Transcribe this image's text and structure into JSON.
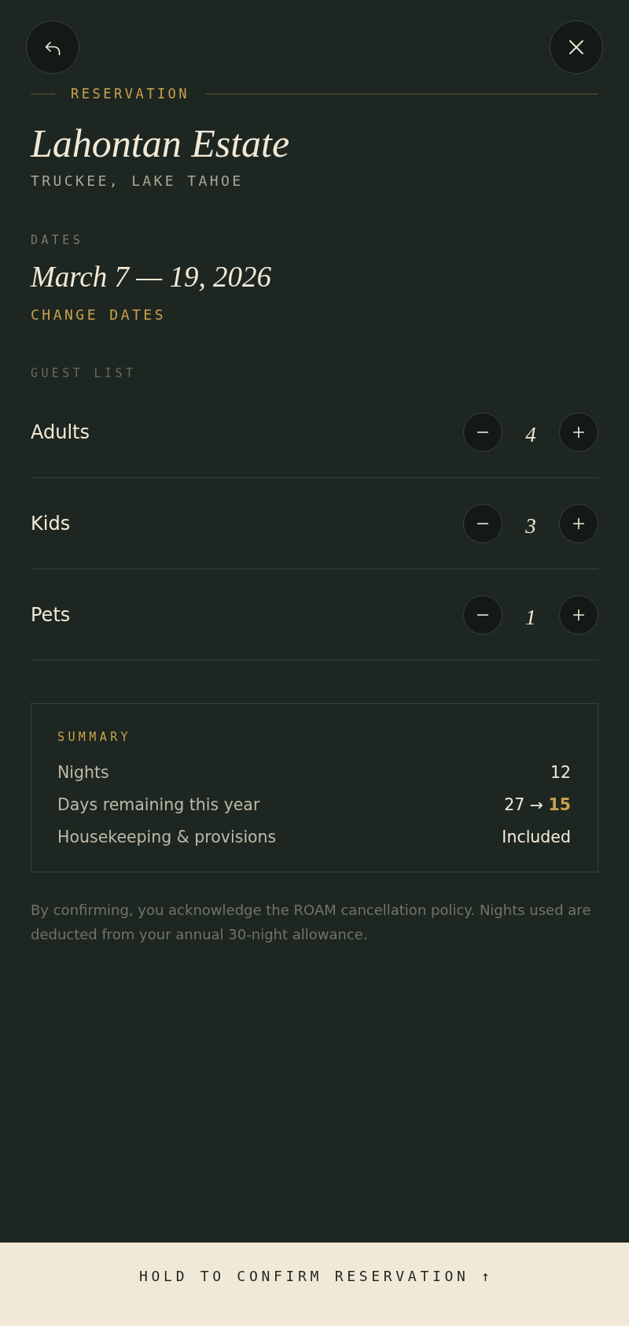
{
  "eyebrow": "RESERVATION",
  "property": {
    "name": "Lahontan Estate",
    "location": "TRUCKEE, LAKE TAHOE"
  },
  "dates": {
    "label": "DATES",
    "range": "March 7 — 19, 2026",
    "action": "CHANGE DATES"
  },
  "guests": {
    "label": "GUEST LIST",
    "rows": [
      {
        "label": "Adults",
        "count": "4"
      },
      {
        "label": "Kids",
        "count": "3"
      },
      {
        "label": "Pets",
        "count": "1"
      }
    ]
  },
  "summary": {
    "title": "SUMMARY",
    "rows": [
      {
        "label": "Nights",
        "value": "12"
      },
      {
        "label": "Days remaining this year",
        "value": "27 → **15**"
      },
      {
        "label": "Housekeeping & provisions",
        "value": "Included"
      }
    ]
  },
  "disclaimer": "By confirming, you acknowledge the ROAM cancellation policy. Nights used are deducted from your annual 30-night allowance.",
  "confirm_button": {
    "label": "HOLD TO CONFIRM RESERVATION ↑"
  }
}
